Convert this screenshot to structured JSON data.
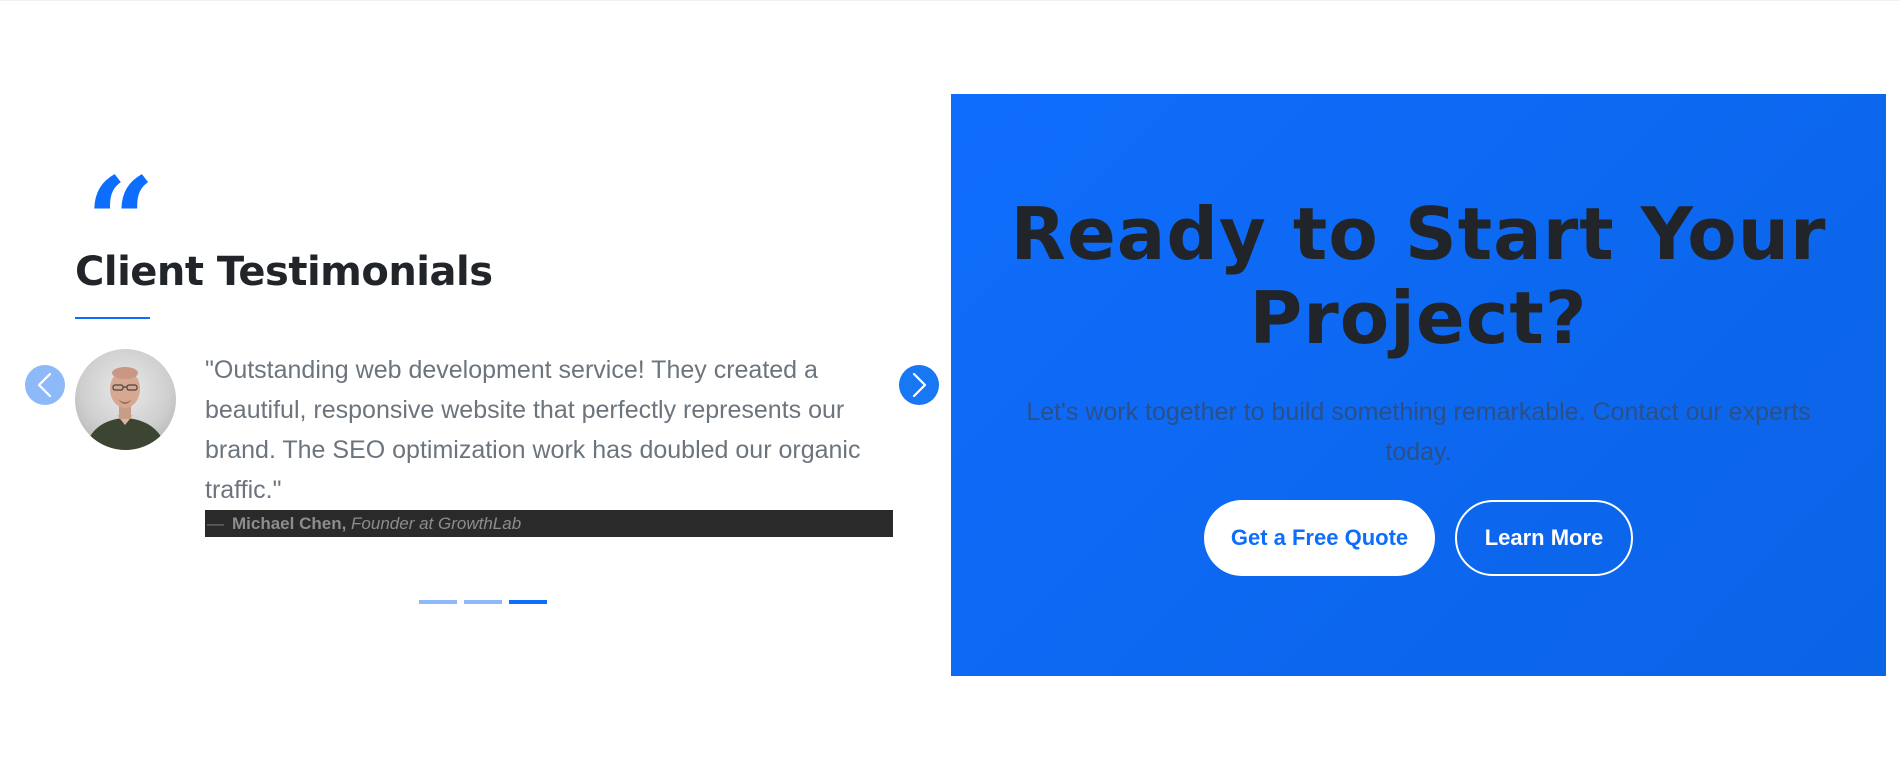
{
  "testimonials": {
    "quote_glyph": "“",
    "title": "Client Testimonials",
    "current": {
      "text": "\"Outstanding web development service! They created a beautiful, responsive website that perfectly represents our brand. The SEO optimization work has doubled our organic traffic.\"",
      "author_dash": "—",
      "author_name": "Michael Chen,",
      "author_role": "Founder at GrowthLab"
    },
    "slide_count": 3,
    "active_slide": 3
  },
  "cta": {
    "title": "Ready to Start Your Project?",
    "subtitle": "Let's work together to build something remarkable. Contact our experts today.",
    "primary_button": "Get a Free Quote",
    "secondary_button": "Learn More"
  },
  "colors": {
    "accent": "#0d6efd",
    "cta_background": "#0f6dfc",
    "heading": "#212529",
    "body_text": "#6c757d",
    "author_bar": "#2a2a2a"
  }
}
